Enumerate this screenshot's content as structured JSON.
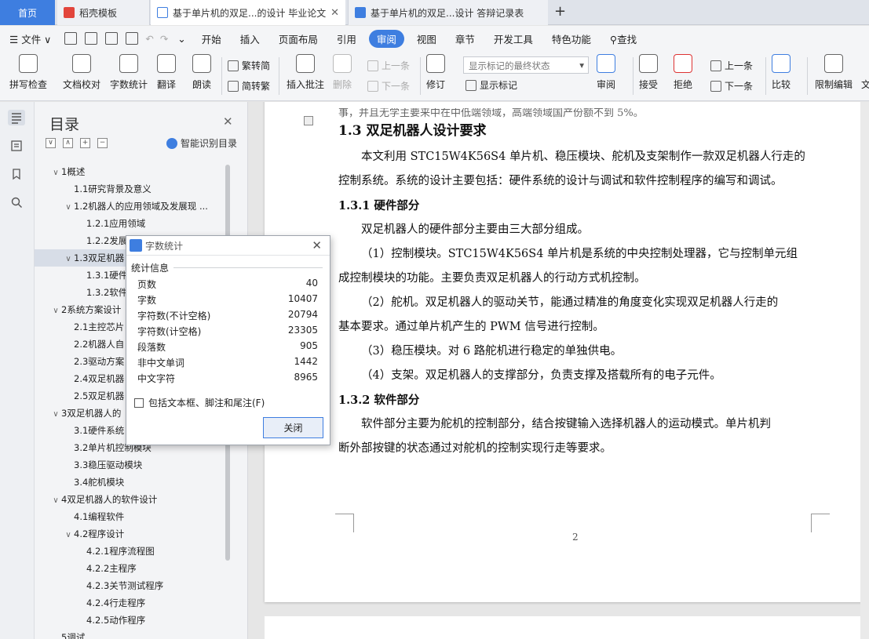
{
  "tabs": {
    "home": "首页",
    "t1": "稻壳模板",
    "t2": "基于单片机的双足...的设计 毕业论文",
    "t3": "基于单片机的双足...设计 答辩记录表",
    "plus": "+",
    "close": "✕"
  },
  "menu": {
    "file": "文件",
    "items": [
      "开始",
      "插入",
      "页面布局",
      "引用",
      "审阅",
      "视图",
      "章节",
      "开发工具",
      "特色功能"
    ],
    "search": "查找"
  },
  "ribbon": {
    "spell": "拼写检查",
    "proof": "文档校对",
    "count": "字数统计",
    "translate": "翻译",
    "read": "朗读",
    "tradconv": "繁转简",
    "simpconv": "简转繁",
    "comment": "插入批注",
    "delete": "删除",
    "prev": "上一条",
    "next": "下一条",
    "revise": "修订",
    "combo": "显示标记的最终状态",
    "showmark": "显示标记",
    "review": "审阅",
    "accept": "接受",
    "reject": "拒绝",
    "prev2": "上一条",
    "next2": "下一条",
    "compare": "比较",
    "restrict": "限制编辑",
    "more": "文"
  },
  "toc": {
    "title": "目录",
    "ai": "智能识别目录",
    "items": [
      {
        "t": "1概述",
        "lv": 0,
        "tg": "∨"
      },
      {
        "t": "1.1研究背景及意义",
        "lv": 1,
        "tg": ""
      },
      {
        "t": "1.2机器人的应用领域及发展现 ...",
        "lv": 1,
        "tg": "∨"
      },
      {
        "t": "1.2.1应用领域",
        "lv": 2,
        "tg": ""
      },
      {
        "t": "1.2.2发展",
        "lv": 2,
        "tg": ""
      },
      {
        "t": "1.3双足机器",
        "lv": 1,
        "tg": "∨"
      },
      {
        "t": "1.3.1硬件",
        "lv": 2,
        "tg": ""
      },
      {
        "t": "1.3.2软件",
        "lv": 2,
        "tg": ""
      },
      {
        "t": "2系统方案设计",
        "lv": 0,
        "tg": "∨"
      },
      {
        "t": "2.1主控芯片",
        "lv": 1,
        "tg": ""
      },
      {
        "t": "2.2机器人自",
        "lv": 1,
        "tg": ""
      },
      {
        "t": "2.3驱动方案",
        "lv": 1,
        "tg": ""
      },
      {
        "t": "2.4双足机器",
        "lv": 1,
        "tg": ""
      },
      {
        "t": "2.5双足机器",
        "lv": 1,
        "tg": ""
      },
      {
        "t": "3双足机器人的",
        "lv": 0,
        "tg": "∨"
      },
      {
        "t": "3.1硬件系统",
        "lv": 1,
        "tg": ""
      },
      {
        "t": "3.2单片机控制模块",
        "lv": 1,
        "tg": ""
      },
      {
        "t": "3.3稳压驱动模块",
        "lv": 1,
        "tg": ""
      },
      {
        "t": "3.4舵机模块",
        "lv": 1,
        "tg": ""
      },
      {
        "t": "4双足机器人的软件设计",
        "lv": 0,
        "tg": "∨"
      },
      {
        "t": "4.1编程软件",
        "lv": 1,
        "tg": ""
      },
      {
        "t": "4.2程序设计",
        "lv": 1,
        "tg": "∨"
      },
      {
        "t": "4.2.1程序流程图",
        "lv": 2,
        "tg": ""
      },
      {
        "t": "4.2.2主程序",
        "lv": 2,
        "tg": ""
      },
      {
        "t": "4.2.3关节测试程序",
        "lv": 2,
        "tg": ""
      },
      {
        "t": "4.2.4行走程序",
        "lv": 2,
        "tg": ""
      },
      {
        "t": "4.2.5动作程序",
        "lv": 2,
        "tg": ""
      },
      {
        "t": "5调试",
        "lv": 0,
        "tg": ""
      }
    ]
  },
  "doc": {
    "cut": "事，并且无学主要来中在中低端领域，高端领域国产份额不到 5%。",
    "h2": "1.3 双足机器人设计要求",
    "p1a": "本文利用 STC15W4K56S4 单片机、稳压模块、舵机及支架制作一款双足机器人行走的",
    "p1b": "控制系统。系统的设计主要包括：硬件系统的设计与调试和软件控制程序的编写和调试。",
    "h31": "1.3.1 硬件部分",
    "p2": "双足机器人的硬件部分主要由三大部分组成。",
    "p3a": "（1）控制模块。STC15W4K56S4 单片机是系统的中央控制处理器，它与控制单元组",
    "p3b": "成控制模块的功能。主要负责双足机器人的行动方式机控制。",
    "p4a": "（2）舵机。双足机器人的驱动关节，能通过精准的角度变化实现双足机器人行走的",
    "p4b": "基本要求。通过单片机产生的 PWM 信号进行控制。",
    "p5": "（3）稳压模块。对 6 路舵机进行稳定的单独供电。",
    "p6": "（4）支架。双足机器人的支撑部分，负责支撑及搭载所有的电子元件。",
    "h32": "1.3.2 软件部分",
    "p7a": "软件部分主要为舵机的控制部分，结合按键输入选择机器人的运动模式。单片机判",
    "p7b": "断外部按键的状态通过对舵机的控制实现行走等要求。",
    "page_number": "2"
  },
  "dialog": {
    "title": "字数统计",
    "group": "统计信息",
    "stats": [
      {
        "label": "页数",
        "value": "40"
      },
      {
        "label": "字数",
        "value": "10407"
      },
      {
        "label": "字符数(不计空格)",
        "value": "20794"
      },
      {
        "label": "字符数(计空格)",
        "value": "23305"
      },
      {
        "label": "段落数",
        "value": "905"
      },
      {
        "label": "非中文单词",
        "value": "1442"
      },
      {
        "label": "中文字符",
        "value": "8965"
      }
    ],
    "checkbox": "包括文本框、脚注和尾注(F)",
    "close_btn": "关闭"
  },
  "colors": {
    "accent": "#3e7ee0"
  }
}
